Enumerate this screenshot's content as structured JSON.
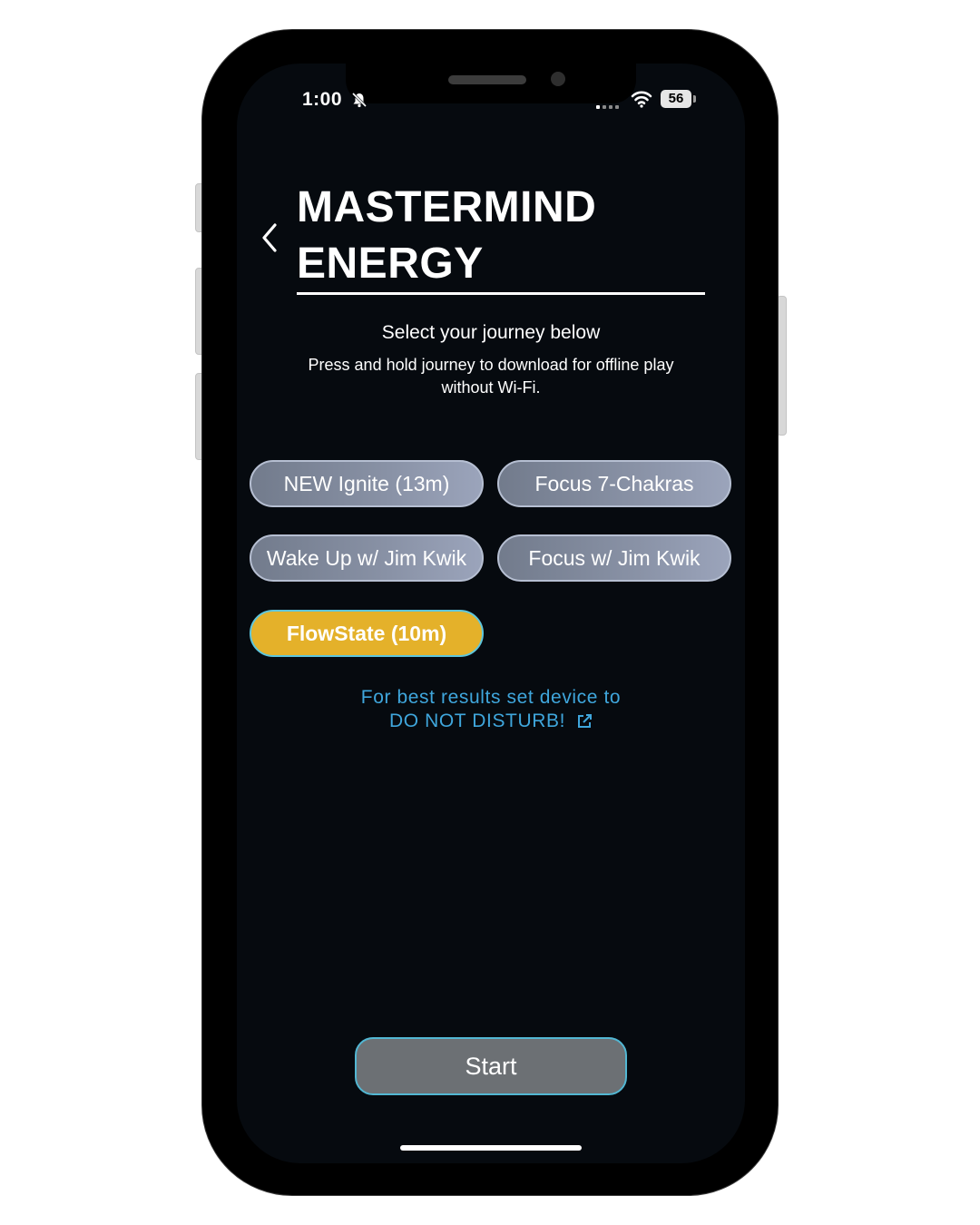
{
  "status_bar": {
    "time": "1:00",
    "battery": "56"
  },
  "header": {
    "back_icon": "chevron-left-icon",
    "title_line1": "MASTERMIND",
    "title_line2": "ENERGY"
  },
  "instructions": {
    "subtitle": "Select your journey below",
    "hint": "Press and hold journey to download for offline play without Wi-Fi."
  },
  "journeys": [
    {
      "label": "NEW Ignite (13m)",
      "selected": false
    },
    {
      "label": "Focus 7-Chakras",
      "selected": false
    },
    {
      "label": "Wake Up w/ Jim Kwik",
      "selected": false
    },
    {
      "label": "Focus w/ Jim Kwik",
      "selected": false
    },
    {
      "label": "FlowState (10m)",
      "selected": true
    }
  ],
  "dnd_notice": {
    "line1": "For best results set device to",
    "line2": "DO NOT DISTURB!",
    "icon": "external-link-icon"
  },
  "start_button": {
    "label": "Start"
  },
  "colors": {
    "background": "#060a0f",
    "selected_journey": "#e4b12a",
    "accent_border": "#52b7d3",
    "link_blue": "#3fa6dc",
    "start_button": "#6c7074"
  }
}
